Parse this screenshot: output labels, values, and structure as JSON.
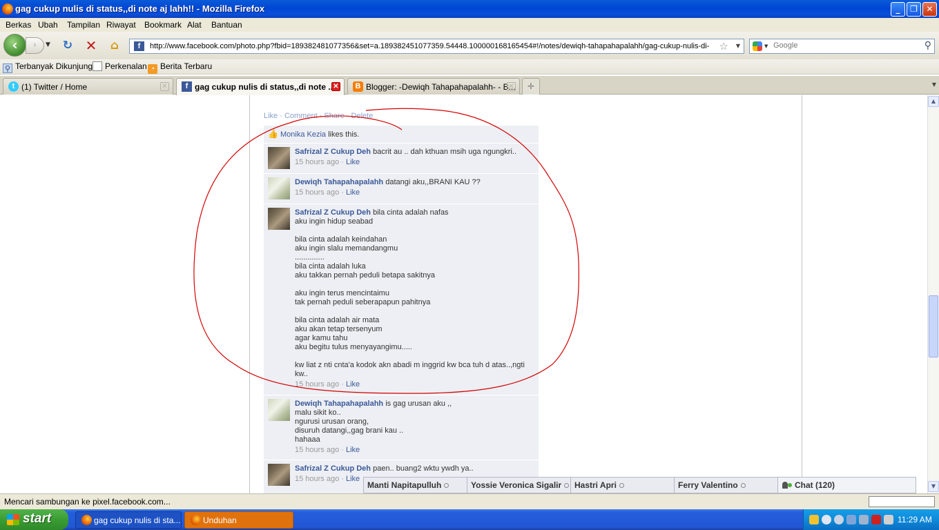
{
  "window": {
    "title": "gag cukup nulis di status,,di note aj lahh!! - Mozilla Firefox",
    "buttons": {
      "minimize": "_",
      "maximize": "❐",
      "close": "✕"
    }
  },
  "menu": [
    "Berkas",
    "Ubah",
    "Tampilan",
    "Riwayat",
    "Bookmark",
    "Alat",
    "Bantuan"
  ],
  "nav": {
    "url": "http://www.facebook.com/photo.php?fbid=189382481077356&set=a.189382451077359.54448.100000168165454#!/notes/dewiqh-tahapahapalahh/gag-cukup-nulis-di-",
    "search_placeholder": "Google",
    "favicon": "f"
  },
  "bookmarks": [
    {
      "label": "Terbanyak Dikunjungi",
      "icon": "folder-search-icon"
    },
    {
      "label": "Perkenalan",
      "icon": "page-icon"
    },
    {
      "label": "Berita Terbaru",
      "icon": "rss-icon"
    }
  ],
  "tabs": [
    {
      "label": "(1) Twitter / Home",
      "icon": "twitter-bird-icon",
      "active": false
    },
    {
      "label": "gag cukup nulis di status,,di note ...",
      "icon": "facebook-icon",
      "active": true
    },
    {
      "label": "Blogger: -Dewiqh Tahapahapalahh- - B...",
      "icon": "blogger-icon",
      "active": false
    }
  ],
  "note": {
    "actions": "Like · Comment · Share · Delete",
    "likes": {
      "name": "Monika Kezia",
      "suffix": " likes this."
    }
  },
  "comments": [
    {
      "author": "Safrizal Z Cukup Deh",
      "text": "bacrit au .. dah kthuan msih uga ngungkri..",
      "time": "15 hours ago",
      "like": "Like"
    },
    {
      "author": "Dewiqh Tahapahapalahh",
      "text": "datangi aku,,BRANI KAU ??",
      "time": "15 hours ago",
      "like": "Like"
    },
    {
      "author": "Safrizal Z Cukup Deh",
      "text": "bila cinta adalah nafas\naku ingin hidup seabad\n\nbila cinta adalah keindahan\naku ingin slalu memandangmu\n..............\nbila cinta adalah luka\naku takkan pernah peduli betapa sakitnya\n\naku ingin terus mencintaimu\ntak pernah peduli seberapapun pahitnya\n\nbila cinta adalah air mata\naku akan tetap tersenyum\nagar kamu tahu\naku begitu tulus menyayangimu.....\n\nkw liat z nti cnta'a kodok akn abadi m inggrid kw bca tuh d atas..,ngti kw..",
      "time": "15 hours ago",
      "like": "Like"
    },
    {
      "author": "Dewiqh Tahapahapalahh",
      "text": "is gag urusan aku ,,\nmalu sikit ko..\nngurusi urusan orang,\ndisuruh datangi,,gag brani kau ..\nhahaaa",
      "time": "15 hours ago",
      "like": "Like"
    },
    {
      "author": "Safrizal Z Cukup Deh",
      "text": "paen.. buang2 wktu ywdh ya..",
      "time": "15 hours ago",
      "like": "Like"
    }
  ],
  "chat": {
    "tabs": [
      "Manti Napitapulluh",
      "Yossie Veronica Sigalir",
      "Hastri Apri",
      "Ferry Valentino"
    ],
    "main": "Chat (120)"
  },
  "status": "Mencari sambungan ke pixel.facebook.com...",
  "taskbar": {
    "start": "start",
    "tasks": [
      "gag cukup nulis di sta...",
      "Unduhan"
    ],
    "clock": "11:29 AM"
  },
  "colors": {
    "facebook_blue": "#3b5998",
    "comment_bg": "#edeff4",
    "annotation_red": "#d40000"
  }
}
